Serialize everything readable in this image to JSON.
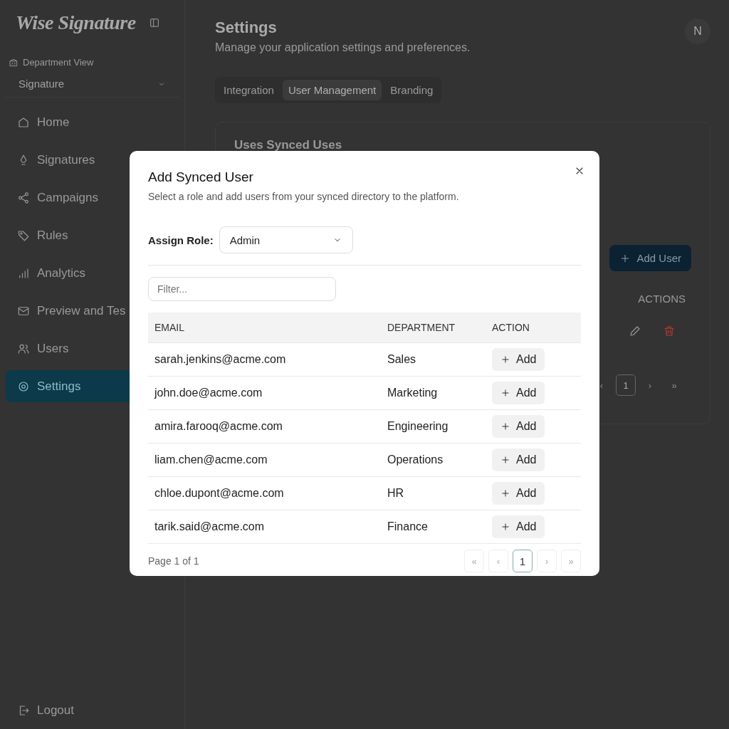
{
  "sidebar": {
    "logo": "Wise Signature",
    "department_label": "Department View",
    "department_select": "Signature",
    "items": [
      {
        "label": "Home",
        "selected": false
      },
      {
        "label": "Signatures",
        "selected": false
      },
      {
        "label": "Campaigns",
        "selected": false
      },
      {
        "label": "Rules",
        "selected": false
      },
      {
        "label": "Analytics",
        "selected": false
      },
      {
        "label": "Preview and Tes",
        "selected": false
      },
      {
        "label": "Users",
        "selected": false
      },
      {
        "label": "Settings",
        "selected": true
      }
    ],
    "logout": "Logout"
  },
  "header": {
    "title": "Settings",
    "subtitle": "Manage your application settings and preferences.",
    "avatar": "N"
  },
  "tabs": [
    {
      "label": "Integration",
      "selected": false
    },
    {
      "label": "User Management",
      "selected": true
    },
    {
      "label": "Branding",
      "selected": false
    }
  ],
  "card": {
    "title": "Uses Synced Uses",
    "add_button": "Add User",
    "actions_header": "ACTIONS",
    "pages": [
      {
        "label": "‹",
        "selected": false
      },
      {
        "label": "1",
        "selected": true
      },
      {
        "label": "›",
        "selected": false
      },
      {
        "label": "»",
        "selected": false
      }
    ]
  },
  "dialog": {
    "title": "Add Synced User",
    "subtitle": "Select a role and add users from your synced directory to the platform.",
    "role_label": "Assign Role:",
    "role_value": "Admin",
    "filter_placeholder": "Filter...",
    "columns": [
      "EMAIL",
      "DEPARTMENT",
      "ACTION"
    ],
    "rows": [
      {
        "email": "sarah.jenkins@acme.com",
        "department": "Sales",
        "action": "Add"
      },
      {
        "email": "john.doe@acme.com",
        "department": "Marketing",
        "action": "Add"
      },
      {
        "email": "amira.farooq@acme.com",
        "department": "Engineering",
        "action": "Add"
      },
      {
        "email": "liam.chen@acme.com",
        "department": "Operations",
        "action": "Add"
      },
      {
        "email": "chloe.dupont@acme.com",
        "department": "HR",
        "action": "Add"
      },
      {
        "email": "tarik.said@acme.com",
        "department": "Finance",
        "action": "Add"
      }
    ],
    "page_info": "Page 1 of 1",
    "pages": [
      {
        "label": "«",
        "selected": false
      },
      {
        "label": "‹",
        "selected": false
      },
      {
        "label": "1",
        "selected": true
      },
      {
        "label": "›",
        "selected": false
      },
      {
        "label": "»",
        "selected": false
      }
    ]
  }
}
